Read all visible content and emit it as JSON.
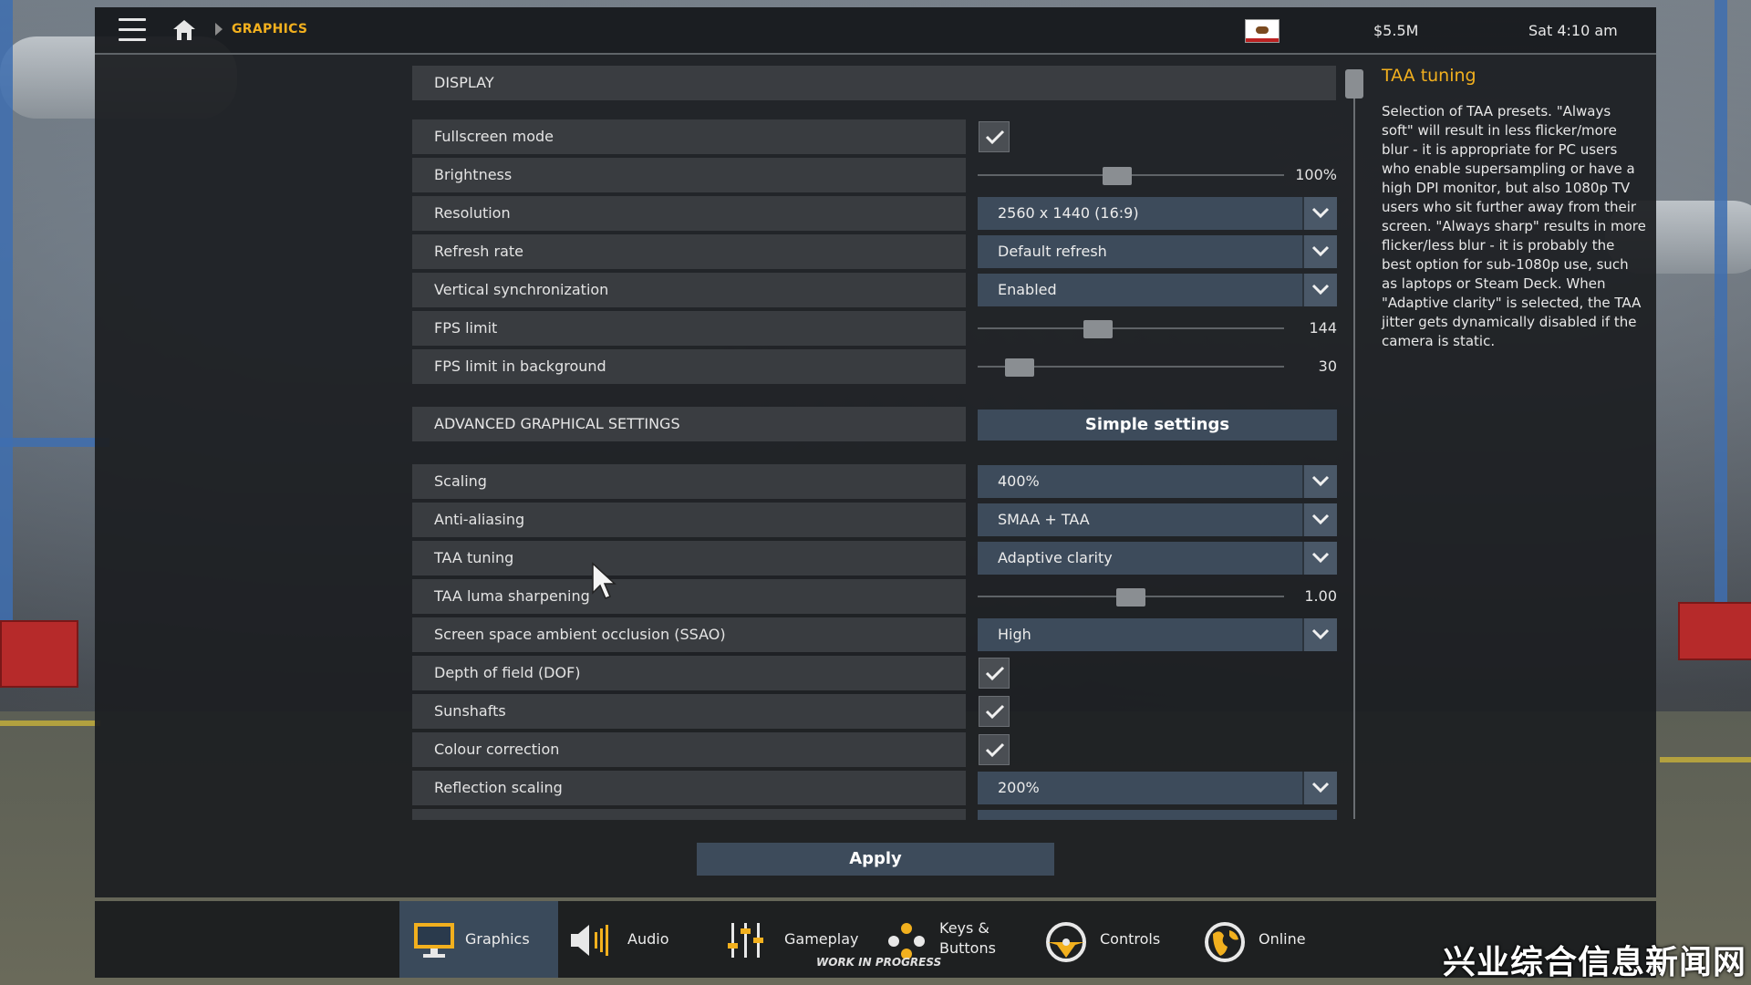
{
  "topbar": {
    "breadcrumb": "GRAPHICS",
    "money": "$5.5M",
    "clock": "Sat 4:10 am",
    "icons": [
      "menu-icon",
      "home-icon",
      "california-flag-icon"
    ]
  },
  "display": {
    "header": "DISPLAY",
    "rows": {
      "fullscreen": {
        "label": "Fullscreen mode",
        "checked": true
      },
      "brightness": {
        "label": "Brightness",
        "value": "100%",
        "level": 0.45
      },
      "resolution": {
        "label": "Resolution",
        "value": "2560 x 1440 (16:9)"
      },
      "refresh": {
        "label": "Refresh rate",
        "value": "Default refresh"
      },
      "vsync": {
        "label": "Vertical synchronization",
        "value": "Enabled"
      },
      "fps": {
        "label": "FPS limit",
        "value": "144",
        "level": 0.38
      },
      "fps_bg": {
        "label": "FPS limit in background",
        "value": "30",
        "level": 0.1
      }
    }
  },
  "advanced": {
    "header": "ADVANCED GRAPHICAL SETTINGS",
    "simple_button": "Simple settings",
    "rows": {
      "scaling": {
        "label": "Scaling",
        "value": "400%"
      },
      "aa": {
        "label": "Anti-aliasing",
        "value": "SMAA + TAA"
      },
      "taa": {
        "label": "TAA tuning",
        "value": "Adaptive clarity"
      },
      "luma": {
        "label": "TAA luma sharpening",
        "value": "1.00",
        "level": 0.5
      },
      "ssao": {
        "label": "Screen space ambient occlusion (SSAO)",
        "value": "High"
      },
      "dof": {
        "label": "Depth of field (DOF)",
        "checked": true
      },
      "sunshafts": {
        "label": "Sunshafts",
        "checked": true
      },
      "colour": {
        "label": "Colour correction",
        "checked": true
      },
      "reflection": {
        "label": "Reflection scaling",
        "value": "200%"
      }
    }
  },
  "apply_button": "Apply",
  "info": {
    "title": "TAA tuning",
    "body": "Selection of TAA presets. \"Always soft\" will result in less flicker/more blur - it is appropriate for PC users who enable supersampling or have a high DPI monitor, but also 1080p TV users who sit further away from their screen. \"Always sharp\" results in more flicker/less blur - it is probably the best option for sub-1080p use, such as laptops or Steam Deck. When \"Adaptive clarity\" is selected, the TAA jitter gets dynamically disabled if the camera is static."
  },
  "nav": {
    "graphics": "Graphics",
    "audio": "Audio",
    "gameplay": "Gameplay",
    "gameplay_note": "WORK IN PROGRESS",
    "keys_line1": "Keys &",
    "keys_line2": "Buttons",
    "controls": "Controls",
    "online": "Online",
    "active": "graphics"
  },
  "watermark": "兴业综合信息新闻网",
  "colors": {
    "accent": "#f2b01e",
    "dropdown": "#3d4b5b",
    "label_bg": "#393c40"
  }
}
